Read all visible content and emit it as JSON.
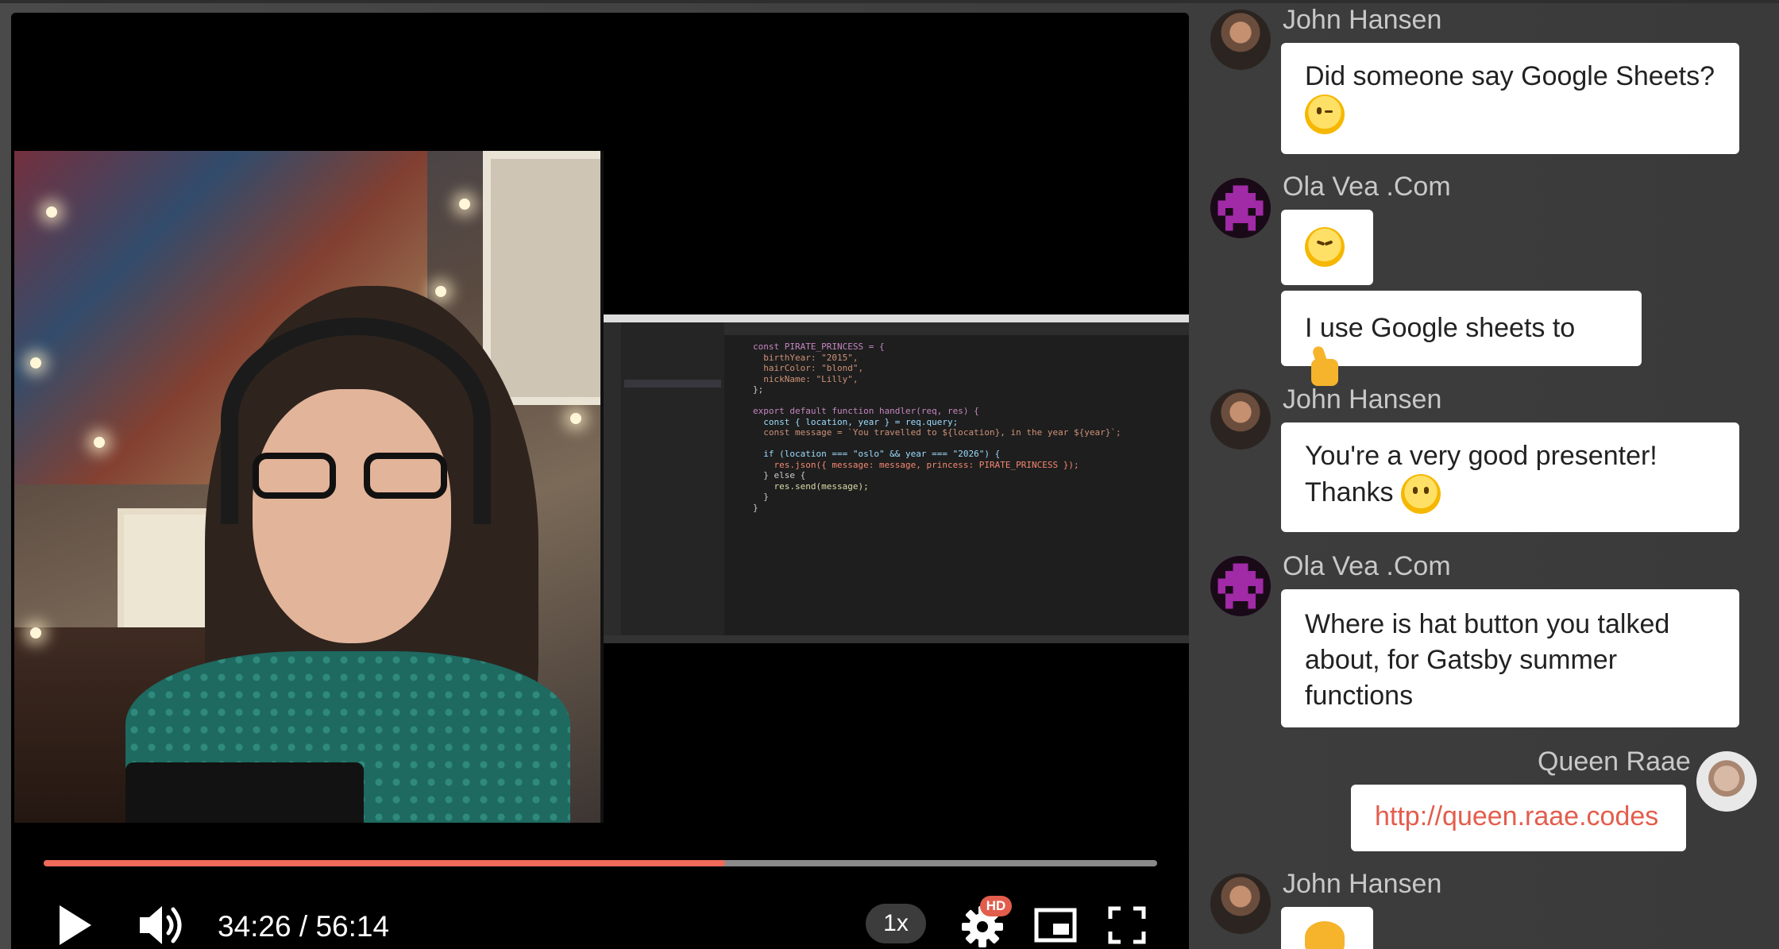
{
  "player": {
    "current_time": "34:26",
    "duration": "56:14",
    "time_separator": " / ",
    "progress": 0.612,
    "speed_label": "1x",
    "hd_badge": "HD",
    "colors": {
      "progress": "#ef6a5a",
      "track": "#8a8a8a",
      "badge": "#e35d4c"
    },
    "icons": [
      "play-icon",
      "volume-icon",
      "gear-icon",
      "picture-in-picture-icon",
      "fullscreen-icon"
    ]
  },
  "code": {
    "lines": [
      "const PIRATE_PRINCESS = {",
      "  birthYear: \"2015\",",
      "  hairColor: \"blond\",",
      "  nickName: \"Lilly\",",
      "};",
      "",
      "export default function handler(req, res) {",
      "  const { location, year } = req.query;",
      "  const message = `You travelled to ${location}, in the year ${year}`;",
      "",
      "  if (location === \"oslo\" && year === \"2026\") {",
      "    res.json({ message: message, princess: PIRATE_PRINCESS });",
      "  } else {",
      "    res.send(message);",
      "  }",
      "}"
    ]
  },
  "chat": {
    "messages": [
      {
        "author": "John Hansen",
        "text_lines": [
          "Did someone say Google Sheets?"
        ],
        "emoji": "wink-emoji"
      },
      {
        "author": "Ola Vea .Com",
        "emoji": "grinning-squinting-emoji"
      },
      {
        "text": "I use Google sheets to",
        "emoji": "thumbs-up-emoji"
      },
      {
        "author": "John Hansen",
        "text_lines": [
          "You're a very good presenter!",
          "Thanks"
        ],
        "emoji": "smiling-emoji"
      },
      {
        "author": "Ola Vea .Com",
        "text_lines": [
          "Where is hat button you talked",
          "about, for Gatsby summer",
          "functions"
        ]
      },
      {
        "author": "Queen Raae",
        "link": "http://queen.raae.codes"
      },
      {
        "author": "John Hansen",
        "emoji": "clapping-hands-emoji"
      }
    ],
    "colors": {
      "link": "#e35d4c",
      "author": "#c8c8c8"
    }
  }
}
